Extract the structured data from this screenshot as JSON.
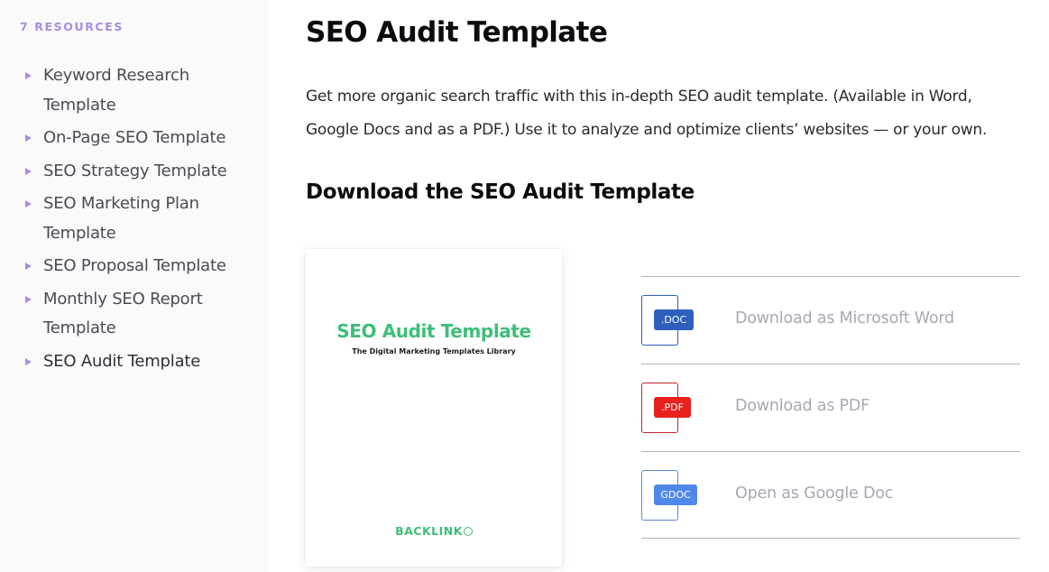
{
  "sidebar": {
    "heading": "7 RESOURCES",
    "accent_color": "#a98be0",
    "items": [
      {
        "label": "Keyword Research Template",
        "active": false
      },
      {
        "label": "On-Page SEO Template",
        "active": false
      },
      {
        "label": "SEO Strategy Template",
        "active": false
      },
      {
        "label": "SEO Marketing Plan Template",
        "active": false
      },
      {
        "label": "SEO Proposal Template",
        "active": false
      },
      {
        "label": "Monthly SEO Report Template",
        "active": false
      },
      {
        "label": "SEO Audit Template",
        "active": true
      }
    ]
  },
  "main": {
    "title": "SEO Audit Template",
    "intro": "Get more organic search traffic with this in-depth SEO audit template. (Available in Word, Google Docs and as a PDF.) Use it to analyze and optimize clients’ websites — or your own.",
    "section_title": "Download the SEO Audit Template",
    "cover": {
      "title": "SEO Audit Template",
      "subtitle": "The Digital Marketing Templates Library",
      "logo_text": "BACKLINK",
      "brand_color": "#3dbf78"
    },
    "downloads": [
      {
        "badge": ".DOC",
        "label": "Download as Microsoft Word",
        "icon": "word-doc-icon",
        "color": "#2e5fbd",
        "badge_width": 44
      },
      {
        "badge": ".PDF",
        "label": "Download as PDF",
        "icon": "pdf-file-icon",
        "color": "#e8201e",
        "sheet_color": "#c6272a",
        "badge_width": 41
      },
      {
        "badge": "GDOC",
        "label": "Open as Google Doc",
        "icon": "google-doc-icon",
        "color": "#4f88ea",
        "sheet_color": "#5c89d6",
        "badge_width": 48
      }
    ]
  }
}
